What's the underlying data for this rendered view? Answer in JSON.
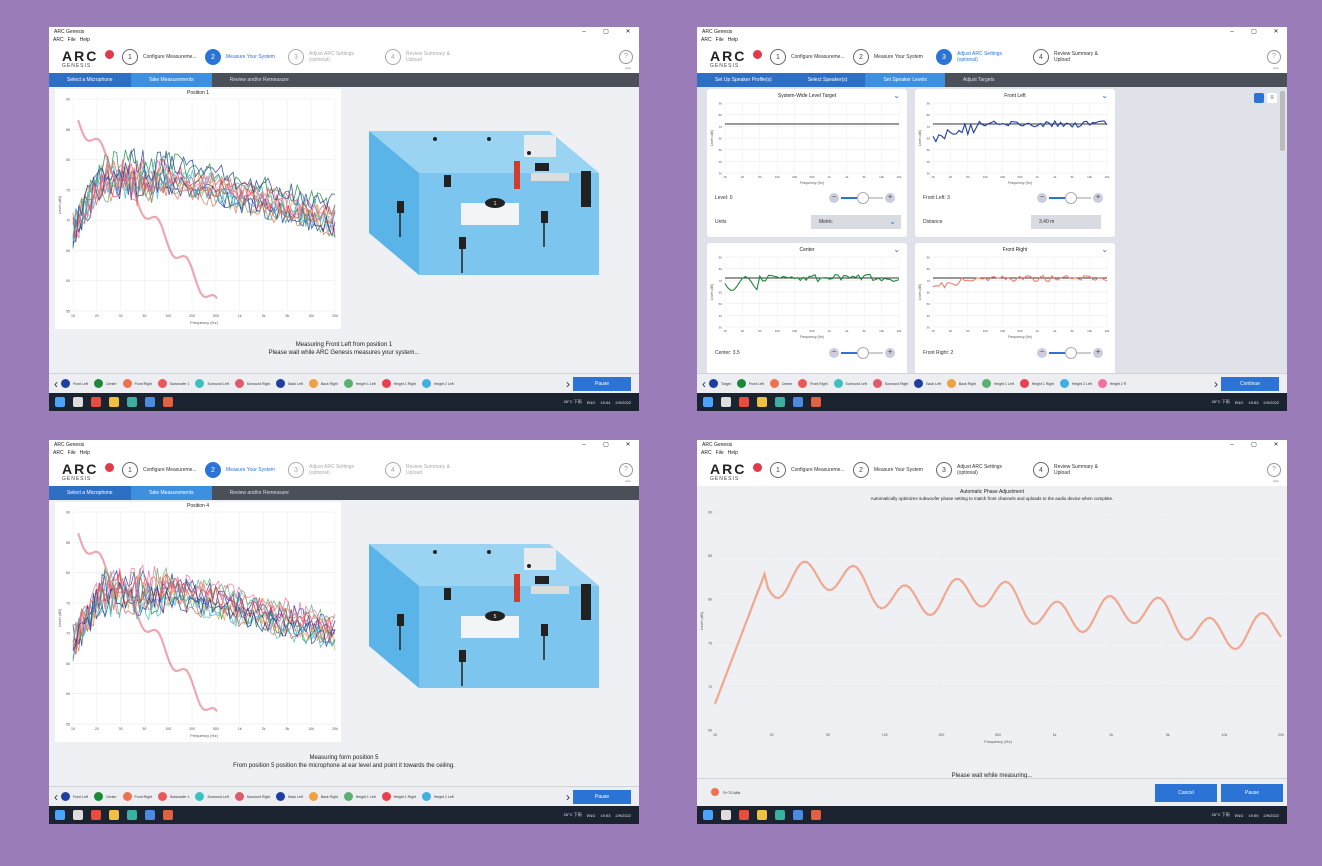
{
  "app": {
    "window_title": "ARC Genesis",
    "menu": [
      "ARC",
      "File",
      "Help"
    ],
    "logo_text": "ARC",
    "logo_sub": "GENESIS",
    "help_label": "Help",
    "win_ctrl": [
      "–",
      "▢",
      "✕"
    ]
  },
  "steps_measure": [
    {
      "num": "1",
      "label": "Configure Measureme..."
    },
    {
      "num": "2",
      "label": "Measure Your System"
    },
    {
      "num": "3",
      "label": "Adjust ARC Settings (optional)"
    },
    {
      "num": "4",
      "label": "Review Summary & Upload"
    }
  ],
  "steps_adjust": [
    {
      "num": "1",
      "label": "Configure Measureme..."
    },
    {
      "num": "2",
      "label": "Measure Your System"
    },
    {
      "num": "3",
      "label": "Adjust ARC Settings (optional)"
    },
    {
      "num": "4",
      "label": "Review Summary & Upload"
    }
  ],
  "steps_phase": [
    {
      "num": "1",
      "label": "Configure Measureme..."
    },
    {
      "num": "2",
      "label": "Measure Your System"
    },
    {
      "num": "3",
      "label": "Adjust ARC Settings (optional)"
    },
    {
      "num": "4",
      "label": "Review Summary & Upload"
    }
  ],
  "subnav_measure": [
    "Select a Microphone",
    "Take Measurements",
    "Review and/or Remeasure"
  ],
  "subnav_adjust": [
    "Set Up Speaker Profile(s)",
    "Select Speaker(s)",
    "Set Speaker Levels",
    "Adjust Targets"
  ],
  "legend_measure": [
    "Front Left",
    "Center",
    "Front Right",
    "Subwoofer 1",
    "Surround Left",
    "Surround Right",
    "Back Left",
    "Back Right",
    "Height 1 Left",
    "Height 1 Right",
    "Height 2 Left"
  ],
  "legend_adjust": [
    "Target",
    "Front Left",
    "Center",
    "Front Right",
    "Surround Left",
    "Surround Right",
    "Back Left",
    "Back Right",
    "Height 1 Left",
    "Height 1 Right",
    "Height 2 Left",
    "Height 2 R"
  ],
  "legend_colors": [
    "#1f3fa0",
    "#1a8a3a",
    "#f07050",
    "#e85a5a",
    "#3cc0c0",
    "#e05a6a",
    "#1f3fa0",
    "#f0a040",
    "#5ab070",
    "#e84050",
    "#40b0e0",
    "#f070a0"
  ],
  "panel1": {
    "chart_title": "Position 1",
    "xlabel": "Frequency (Hz)",
    "ylabel": "Level (dB)",
    "status_line1": "Measuring Front Left from position 1",
    "status_line2": "Please wait while ARC Genesis measures your system...",
    "button": "Pause",
    "time": "19:44",
    "date": "2/9/2022"
  },
  "panel3": {
    "chart_title": "Position 4",
    "xlabel": "Frequency (Hz)",
    "ylabel": "Level (dB)",
    "status_line1": "Measuring form position 5",
    "status_line2": "From position 5 position the microphone at ear level and point it towards the ceiling.",
    "button": "Pause",
    "time": "19:53",
    "date": "2/9/2022"
  },
  "panel2": {
    "cards": [
      {
        "title": "System-Wide Level Target",
        "level_label": "Level: 0",
        "field_label": "Units",
        "field_value": "Metric"
      },
      {
        "title": "Front Left",
        "level_label": "Front Left: 3",
        "field_label": "Distance",
        "field_value": "3.40 m"
      },
      {
        "title": "Center",
        "level_label": "Center: 3.5"
      },
      {
        "title": "Front Right",
        "level_label": "Front Right: 2"
      }
    ],
    "xlabel": "Frequency (Hz)",
    "ylabel": "Level (dB)",
    "button": "Continue",
    "time": "19:53",
    "date": "2/9/2022"
  },
  "panel4": {
    "title": "Automatic Phase Adjustment",
    "subtitle": "Automatically optimizes subwoofer phase setting to match front channels and uploads to the audio device when complete.",
    "xlabel": "Frequency (Hz)",
    "ylabel": "Level (dB)",
    "status": "Please wait while measuring...",
    "legend_item": "S+70-Mid",
    "cancel": "Cancel",
    "pause": "Pause",
    "time": "19:59",
    "date": "2/9/2022"
  },
  "taskbar": {
    "weather": "26°C 下雨",
    "lang": "ENG"
  },
  "y_ticks": [
    "90",
    "85",
    "80",
    "75",
    "70",
    "65",
    "60",
    "55"
  ],
  "y_ticks_phase": [
    "90",
    "85",
    "80",
    "75",
    "70",
    "65"
  ],
  "x_ticks": [
    "15",
    "20",
    "30",
    "50",
    "100",
    "200",
    "500",
    "1k",
    "2k",
    "5k",
    "10k",
    "20k"
  ],
  "card_y_ticks": [
    "90",
    "80",
    "70",
    "60",
    "50",
    "40",
    "30"
  ],
  "card_x_ticks": [
    "15",
    "20",
    "50",
    "100",
    "200",
    "500",
    "1k",
    "2k",
    "5k",
    "10k",
    "20k"
  ],
  "phase_x_ticks": [
    "15",
    "20",
    "50",
    "100",
    "200",
    "500",
    "1k",
    "2k",
    "5k",
    "10k",
    "20k"
  ]
}
